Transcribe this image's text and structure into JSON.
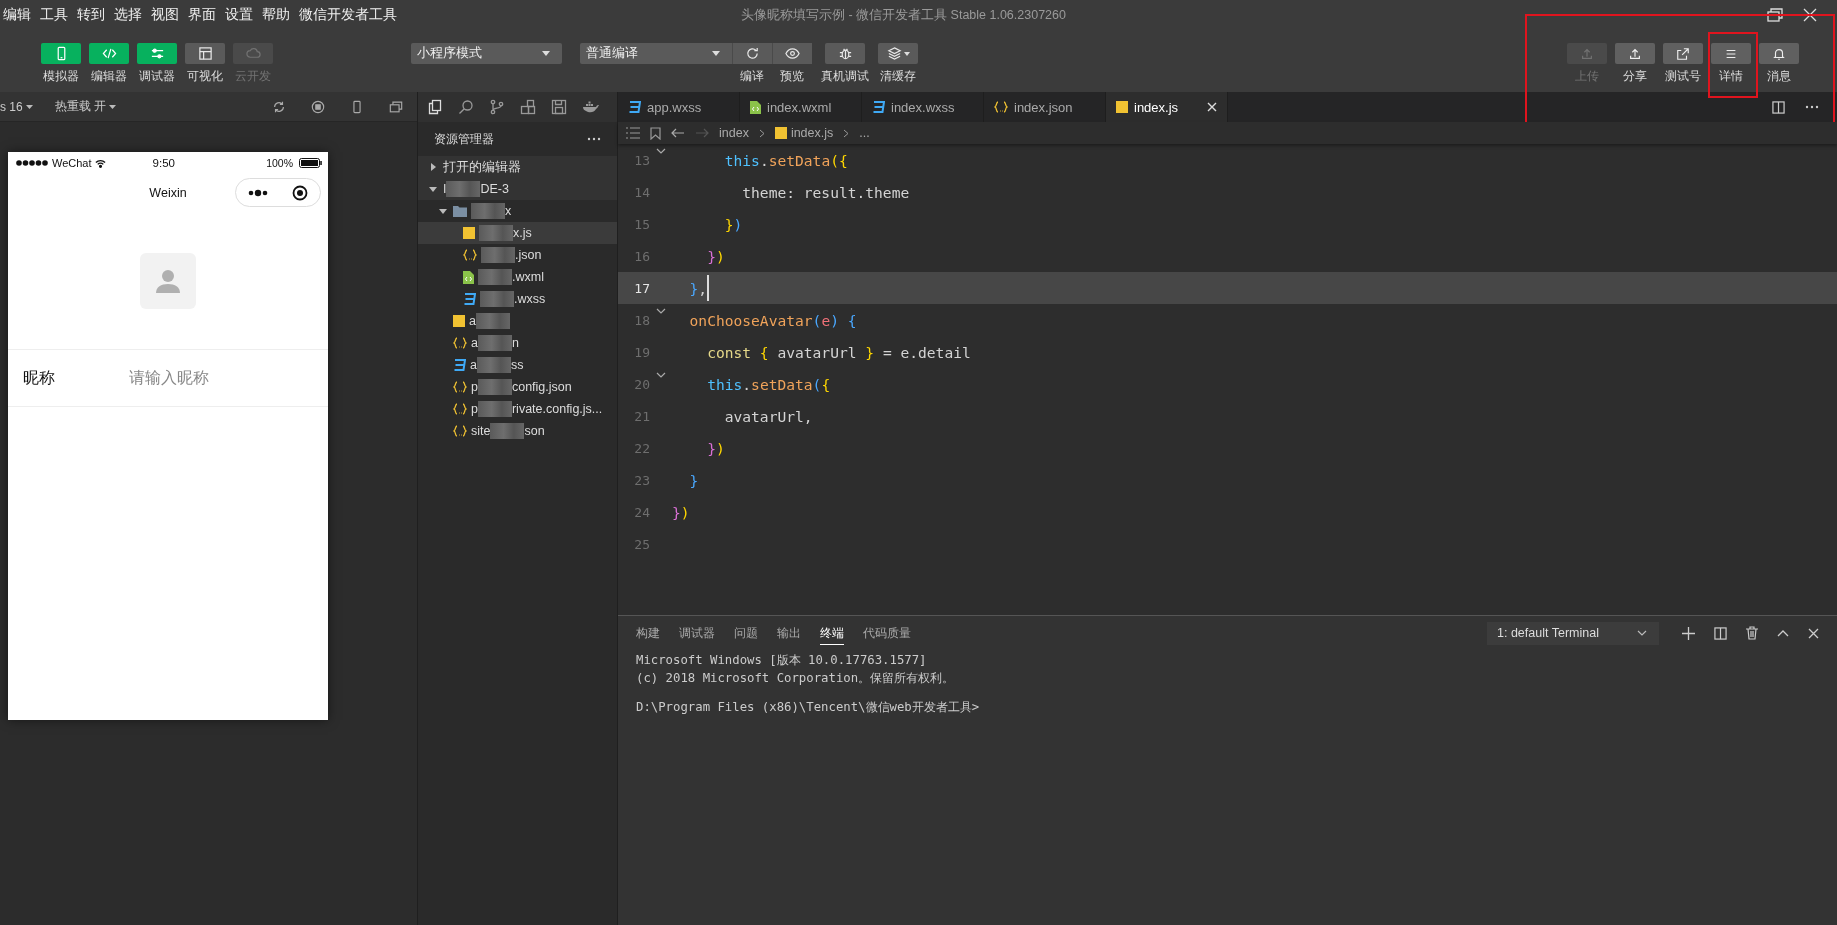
{
  "menu": [
    "编辑",
    "工具",
    "转到",
    "选择",
    "视图",
    "界面",
    "设置",
    "帮助",
    "微信开发者工具"
  ],
  "window": {
    "title": "头像昵称填写示例 - 微信开发者工具 Stable 1.06.2307260"
  },
  "toolbar": {
    "left_buttons": [
      {
        "label": "模拟器",
        "kind": "phone",
        "on": true,
        "disabled": false
      },
      {
        "label": "编辑器",
        "kind": "code",
        "on": true,
        "disabled": false
      },
      {
        "label": "调试器",
        "kind": "sliders",
        "on": true,
        "disabled": false
      },
      {
        "label": "可视化",
        "kind": "layout",
        "on": false,
        "disabled": false
      },
      {
        "label": "云开发",
        "kind": "cloud",
        "on": false,
        "disabled": true
      }
    ],
    "mode_select": "小程序模式",
    "compile_select": "普通编译",
    "compile_buttons": [
      {
        "label": "编译",
        "kind": "refresh"
      },
      {
        "label": "预览",
        "kind": "eye"
      }
    ],
    "tool_buttons": [
      {
        "label": "真机调试",
        "kind": "bug"
      },
      {
        "label": "清缓存",
        "kind": "layers"
      }
    ],
    "right_buttons": [
      {
        "label": "上传",
        "kind": "upload",
        "disabled": true
      },
      {
        "label": "分享",
        "kind": "upload",
        "disabled": false
      },
      {
        "label": "测试号",
        "kind": "external",
        "disabled": false
      },
      {
        "label": "详情",
        "kind": "list",
        "disabled": false
      },
      {
        "label": "消息",
        "kind": "bell",
        "disabled": false
      }
    ]
  },
  "simulator": {
    "device": "s 16",
    "hot_reload": "热重载 开",
    "phone": {
      "carrier": "WeChat",
      "time": "9:50",
      "battery": "100%",
      "nav_title": "Weixin",
      "field_label": "昵称",
      "field_placeholder": "请输入昵称"
    }
  },
  "explorer": {
    "title": "资源管理器",
    "open_editors": {
      "label": "打开的编辑器",
      "expanded": false
    },
    "tree": [
      {
        "kind": "root",
        "prefix": "I",
        "suffix": "DE-3",
        "expanded": true,
        "children": [
          {
            "kind": "folder",
            "suffix": "x",
            "expanded": true,
            "children": [
              {
                "kind": "js",
                "suffix": "x.js",
                "selected": true
              },
              {
                "kind": "json",
                "suffix": ".json",
                "selected": false
              },
              {
                "kind": "wxml",
                "suffix": ".wxml",
                "selected": false
              },
              {
                "kind": "wxss",
                "suffix": ".wxss",
                "selected": false
              }
            ]
          },
          {
            "kind": "js",
            "prefix": "a",
            "selected": false
          },
          {
            "kind": "json",
            "prefix": "a",
            "suffix": "n",
            "selected": false
          },
          {
            "kind": "wxss",
            "prefix": "a",
            "suffix": "ss",
            "selected": false
          },
          {
            "kind": "json",
            "prefix": "p",
            "suffix": "config.json",
            "selected": false
          },
          {
            "kind": "json",
            "prefix": "p",
            "suffix": "rivate.config.js...",
            "selected": false
          },
          {
            "kind": "json",
            "prefix": "site",
            "suffix": "son",
            "selected": false
          }
        ]
      }
    ]
  },
  "editor": {
    "tabs": [
      {
        "label": "app.wxss",
        "kind": "wxss",
        "selected": false
      },
      {
        "label": "index.wxml",
        "kind": "wxml",
        "selected": false
      },
      {
        "label": "index.wxss",
        "kind": "wxss",
        "selected": false
      },
      {
        "label": "index.json",
        "kind": "json",
        "selected": false
      },
      {
        "label": "index.js",
        "kind": "js",
        "selected": true
      }
    ],
    "breadcrumb": [
      {
        "label": "index",
        "kind": "folder"
      },
      {
        "label": "index.js",
        "kind": "js"
      },
      {
        "label": "...",
        "kind": "more"
      }
    ],
    "lines": [
      {
        "number": "13",
        "current": false,
        "foldable": true,
        "tokens": [
          {
            "text": "      this",
            "kind": "kw"
          },
          {
            "text": ".",
            "kind": "plain"
          },
          {
            "text": "setData",
            "kind": "fn"
          },
          {
            "text": "(",
            "kind": "y"
          },
          {
            "text": "{",
            "kind": "y"
          }
        ]
      },
      {
        "number": "14",
        "current": false,
        "foldable": false,
        "tokens": [
          {
            "text": "        theme: result.theme",
            "kind": "plain"
          }
        ]
      },
      {
        "number": "15",
        "current": false,
        "foldable": false,
        "tokens": [
          {
            "text": "      }",
            "kind": "y"
          },
          {
            "text": ")",
            "kind": "b"
          }
        ]
      },
      {
        "number": "16",
        "current": false,
        "foldable": false,
        "tokens": [
          {
            "text": "    }",
            "kind": "p"
          },
          {
            "text": ")",
            "kind": "y"
          }
        ]
      },
      {
        "number": "17",
        "current": true,
        "foldable": false,
        "tokens": [
          {
            "text": "  }",
            "kind": "b"
          },
          {
            "text": ",",
            "kind": "plain"
          }
        ]
      },
      {
        "number": "18",
        "current": false,
        "foldable": true,
        "tokens": [
          {
            "text": "  onChooseAvatar",
            "kind": "fn"
          },
          {
            "text": "(",
            "kind": "b"
          },
          {
            "text": "e",
            "kind": "param"
          },
          {
            "text": ")",
            "kind": "b"
          },
          {
            "text": " {",
            "kind": "b"
          }
        ]
      },
      {
        "number": "19",
        "current": false,
        "foldable": false,
        "tokens": [
          {
            "text": "    const",
            "kind": "const"
          },
          {
            "text": " {",
            "kind": "y"
          },
          {
            "text": " avatarUrl ",
            "kind": "plain"
          },
          {
            "text": "}",
            "kind": "y"
          },
          {
            "text": " = e.detail",
            "kind": "plain"
          }
        ]
      },
      {
        "number": "20",
        "current": false,
        "foldable": true,
        "tokens": [
          {
            "text": "    this",
            "kind": "kw"
          },
          {
            "text": ".",
            "kind": "plain"
          },
          {
            "text": "setData",
            "kind": "fn"
          },
          {
            "text": "(",
            "kind": "b"
          },
          {
            "text": "{",
            "kind": "y"
          }
        ]
      },
      {
        "number": "21",
        "current": false,
        "foldable": false,
        "tokens": [
          {
            "text": "      avatarUrl,",
            "kind": "plain"
          }
        ]
      },
      {
        "number": "22",
        "current": false,
        "foldable": false,
        "tokens": [
          {
            "text": "    }",
            "kind": "p"
          },
          {
            "text": ")",
            "kind": "y"
          }
        ]
      },
      {
        "number": "23",
        "current": false,
        "foldable": false,
        "tokens": [
          {
            "text": "  }",
            "kind": "b"
          }
        ]
      },
      {
        "number": "24",
        "current": false,
        "foldable": false,
        "tokens": [
          {
            "text": "}",
            "kind": "p"
          },
          {
            "text": ")",
            "kind": "y"
          }
        ]
      },
      {
        "number": "25",
        "current": false,
        "foldable": false
      }
    ]
  },
  "panel": {
    "tabs": [
      {
        "label": "构建",
        "selected": false
      },
      {
        "label": "调试器",
        "selected": false
      },
      {
        "label": "问题",
        "selected": false
      },
      {
        "label": "输出",
        "selected": false
      },
      {
        "label": "终端",
        "selected": true
      },
      {
        "label": "代码质量",
        "selected": false
      }
    ],
    "terminal_select": "1: default Terminal",
    "terminal": {
      "banner": [
        "Microsoft Windows [版本 10.0.17763.1577]",
        "(c) 2018 Microsoft Corporation。保留所有权利。"
      ],
      "prompt": "D:\\Program Files (x86)\\Tencent\\微信web开发者工具>"
    }
  }
}
